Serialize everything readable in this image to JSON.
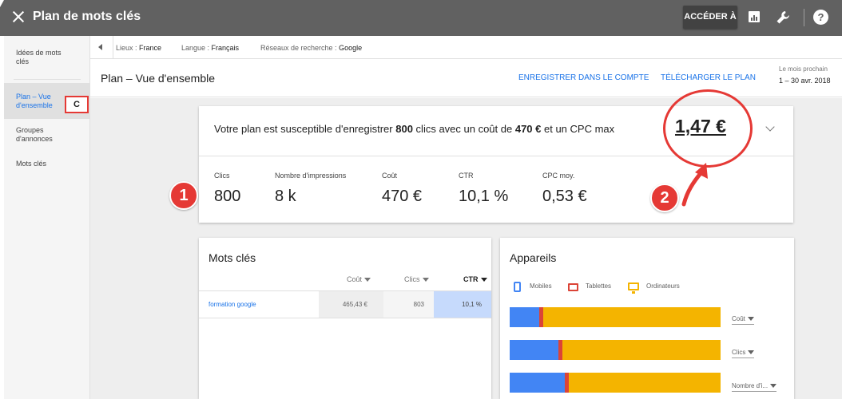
{
  "topbar": {
    "title": "Plan de mots clés",
    "access_label": "ACCÉDER À"
  },
  "sidebar": {
    "items": [
      {
        "label_line1": "Idées de mots",
        "label_line2": "clés"
      },
      {
        "label_line1": "Plan – Vue",
        "label_line2": "d'ensemble"
      },
      {
        "label_line1": "Groupes",
        "label_line2": "d'annonces"
      },
      {
        "label_line1": "Mots clés",
        "label_line2": ""
      }
    ],
    "annotation": "C"
  },
  "filters": {
    "location_label": "Lieux : ",
    "location_value": "France",
    "language_label": "Langue : ",
    "language_value": "Français",
    "network_label": "Réseaux de recherche : ",
    "network_value": "Google"
  },
  "header": {
    "title": "Plan – Vue d'ensemble",
    "save_label": "ENREGISTRER DANS LE COMPTE",
    "download_label": "TÉLÉCHARGER LE PLAN",
    "period_label": "Le mois prochain",
    "period_value": "1 – 30 avr. 2018"
  },
  "summary": {
    "s1": "Votre plan est susceptible d'enregistrer ",
    "clicks": "800",
    "s2": " clics avec un coût de ",
    "cost": "470 €",
    "s3": " et un CPC max",
    "cpc_max": "1,47 €",
    "metrics": [
      {
        "label": "Clics",
        "value": "800"
      },
      {
        "label": "Nombre d'impressions",
        "value": "8 k"
      },
      {
        "label": "Coût",
        "value": "470 €"
      },
      {
        "label": "CTR",
        "value": "10,1 %"
      },
      {
        "label": "CPC moy.",
        "value": "0,53 €"
      }
    ]
  },
  "annotations": {
    "badge1": "1",
    "badge2": "2"
  },
  "keywords": {
    "title": "Mots clés",
    "col_cost": "Coût",
    "col_clicks": "Clics",
    "col_ctr": "CTR",
    "rows": [
      {
        "keyword": "formation google",
        "cost": "465,43 €",
        "clicks": "803",
        "ctr": "10,1 %"
      }
    ]
  },
  "devices": {
    "title": "Appareils",
    "legend_mobile": "Mobiles",
    "legend_tablet": "Tablettes",
    "legend_desktop": "Ordinateurs",
    "bars": [
      {
        "metric": "Coût",
        "mobile": 0.14,
        "tablet": 0.02,
        "desktop": 0.84
      },
      {
        "metric": "Clics",
        "mobile": 0.23,
        "tablet": 0.02,
        "desktop": 0.75
      },
      {
        "metric": "Nombre d'i...",
        "mobile": 0.26,
        "tablet": 0.02,
        "desktop": 0.72
      }
    ]
  },
  "colors": {
    "topbar": "#616161",
    "accent": "#1a73e8",
    "mobile": "#4285f4",
    "tablet": "#db4437",
    "desktop": "#f4b400",
    "annotation": "#e53935"
  }
}
